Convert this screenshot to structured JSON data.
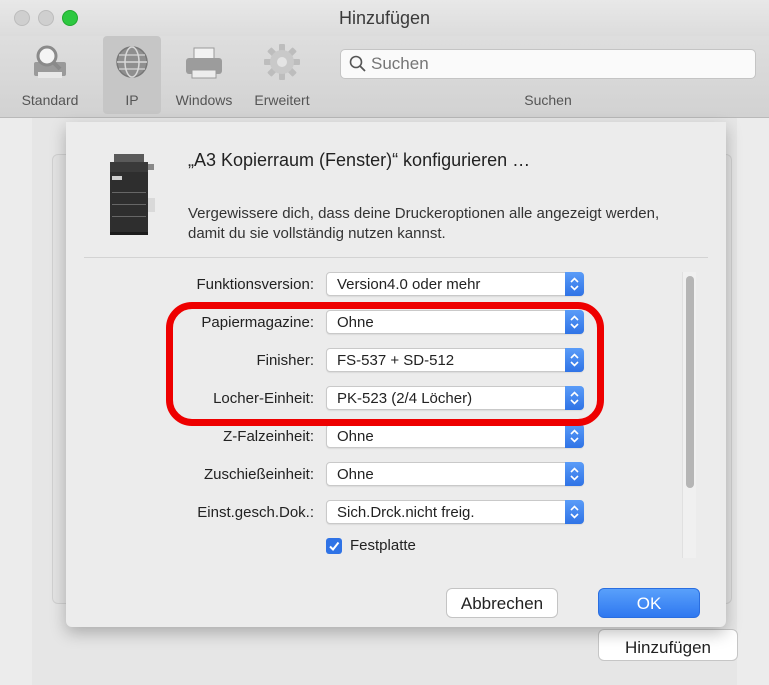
{
  "window": {
    "title": "Hinzufügen"
  },
  "toolbar": {
    "items": [
      {
        "label": "Standard",
        "icon": "magnifier-printer-icon"
      },
      {
        "label": "IP",
        "icon": "globe-icon"
      },
      {
        "label": "Windows",
        "icon": "printer-icon"
      },
      {
        "label": "Erweitert",
        "icon": "gear-icon"
      }
    ],
    "search_placeholder": "Suchen",
    "search_caption": "Suchen"
  },
  "background": {
    "add_button": "Hinzufügen"
  },
  "sheet": {
    "title": "„A3 Kopierraum (Fenster)“ konfigurieren …",
    "description": "Vergewissere dich, dass deine Druckeroptionen alle angezeigt werden, damit du sie vollständig nutzen kannst.",
    "options": [
      {
        "label": "Funktionsversion:",
        "value": "Version4.0 oder mehr"
      },
      {
        "label": "Papiermagazine:",
        "value": "Ohne"
      },
      {
        "label": "Finisher:",
        "value": "FS-537 + SD-512"
      },
      {
        "label": "Locher-Einheit:",
        "value": "PK-523 (2/4 Löcher)"
      },
      {
        "label": "Z-Falzeinheit:",
        "value": "Ohne"
      },
      {
        "label": "Zuschießeinheit:",
        "value": "Ohne"
      },
      {
        "label": "Einst.gesch.Dok.:",
        "value": "Sich.Drck.nicht freig."
      }
    ],
    "checkbox": {
      "label": "Festplatte",
      "checked": true
    },
    "cancel_label": "Abbrechen",
    "ok_label": "OK"
  },
  "colors": {
    "accent": "#2f73e6",
    "highlight": "#ee0000"
  }
}
